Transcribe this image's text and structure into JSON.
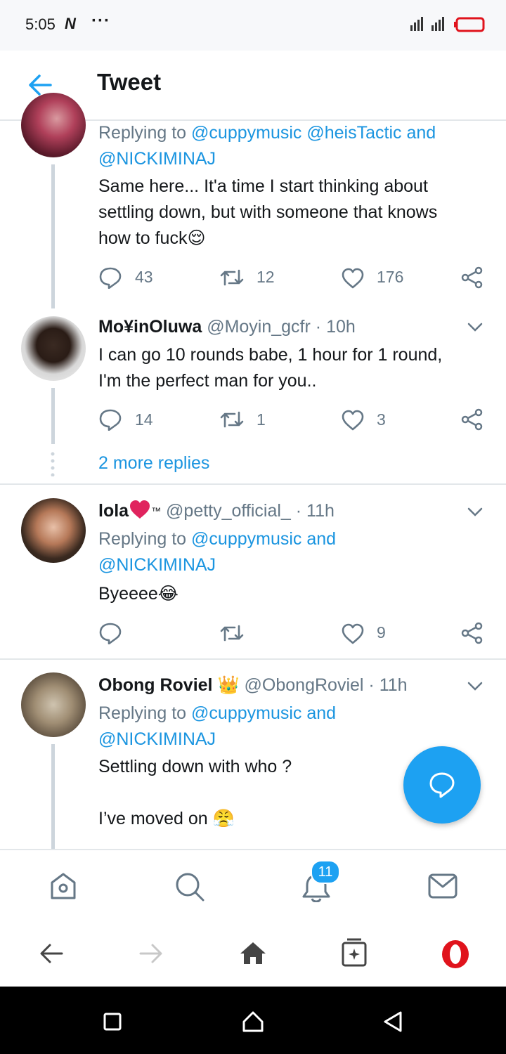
{
  "status_bar": {
    "time": "5:05",
    "network_glyph": "N",
    "more": "···"
  },
  "header": {
    "title": "Tweet",
    "back_icon": "back-arrow-icon"
  },
  "tweets": [
    {
      "replying_prefix": "Replying to",
      "replying_line1": "@cuppymusic @heisTactic and",
      "replying_line2": "@NICKIMINAJ",
      "text_line1": "Same here... It'a time I start thinking about",
      "text_line2": "settling down, but with someone that knows",
      "text_line3": "how to fuck",
      "emoji": "😌",
      "replies": "43",
      "retweets": "12",
      "likes": "176"
    },
    {
      "name": "Mo¥inOluwa",
      "handle": "@Moyin_gcfr",
      "time": "· 10h",
      "text_line1": "I can go 10 rounds babe, 1 hour for 1 round,",
      "text_line2": "I'm the perfect man for you..",
      "replies": "14",
      "retweets": "1",
      "likes": "3"
    },
    {
      "name": "lola",
      "name_suffix": "™",
      "handle": "@petty_official_",
      "time": "· 11h",
      "replying_prefix": "Replying to",
      "replying_line1": "@cuppymusic and",
      "replying_line2": "@NICKIMINAJ",
      "text_line1": "Byeeee",
      "emoji": "😂",
      "replies": "",
      "retweets": "",
      "likes": "9"
    },
    {
      "name": "Obong Roviel",
      "name_emoji": "👑",
      "handle": "@ObongRoviel",
      "time": "· 11h",
      "replying_prefix": "Replying to",
      "replying_line1": "@cuppymusic and",
      "replying_line2": "@NICKIMINAJ",
      "text_line1": "Settling down with who ?",
      "text_line2": "I’ve moved on",
      "emoji": "😤"
    }
  ],
  "more_replies": "2 more replies",
  "tab_bar": {
    "notifications_badge": "11"
  },
  "colors": {
    "accent": "#1da1f2",
    "link": "#1b95e0",
    "muted": "#657786",
    "heart": "#e0245e",
    "opera": "#e0131c"
  }
}
